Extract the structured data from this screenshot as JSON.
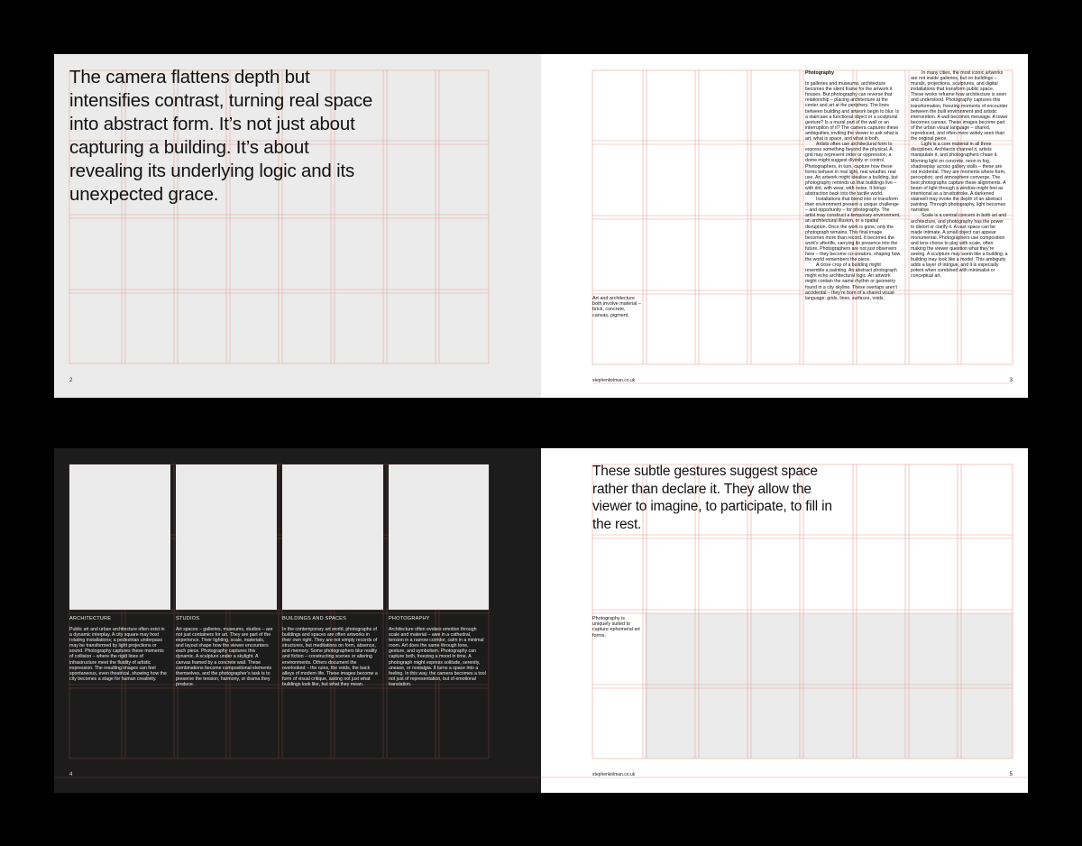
{
  "spread1": {
    "left": {
      "quote": "The camera flattens depth but intensifies contrast, turning real space into abstract form. It’s not just about capturing a building. It’s about revealing its underlying logic and its unexpected grace.",
      "page_number": "2"
    },
    "right": {
      "caption": "Art and architecture both involve material – brick, concrete, canvas, pigment.",
      "heading": "Photography",
      "col1": [
        "In galleries and museums, architecture becomes the silent frame for the artwork it houses. But photography can reverse that relationship – placing architecture at the center and art at the periphery. The lines between building and artwork begin to blur. Is a staircase a functional object or a sculptural gesture? Is a mural part of the wall or an interruption of it? The camera captures these ambiguities, inviting the viewer to ask what is art, what is space, and what is both.",
        "Artists often use architectural form to express something beyond the physical. A grid may represent order or oppression; a dome might suggest divinity or control. Photographers, in turn, capture how these forms behave in real light, real weather, real use. An artwork might idealise a building, but photography reminds us that buildings live – with dirt, with wear, with noise. It brings abstraction back into the tactile world.",
        "Installations that blend into or transform their environment present a unique challenge – and opportunity – for photography. The artist may construct a temporary environment, an architectural illusion, or a spatial disruption. Once the work is gone, only the photograph remains. This final image becomes more than record. It becomes the work’s afterlife, carrying its presence into the future. Photographers are not just observers here – they become co-creators, shaping how the world remembers the piece.",
        "A close crop of a building might resemble a painting. An abstract photograph might echo architectural logic. An artwork might contain the same rhythm or geometry found in a city skyline. These overlaps aren’t accidental – they’re born of a shared visual language: grids, lines, surfaces, voids."
      ],
      "col2": [
        "In many cities, the most iconic artworks are not inside galleries, but on buildings – murals, projections, sculptures, and digital installations that transform public space. These works reframe how architecture is seen and understood. Photography captures this transformation, freezing moments of encounter between the built environment and artistic intervention. A wall becomes message. A tower becomes canvas. These images become part of the urban visual language – shared, reproduced, and often more widely seen than the original piece.",
        "Light is a core material in all three disciplines. Architects channel it, artists manipulate it, and photographers chase it. Morning light on concrete, neon in fog, shadowplay across gallery walls – these are not incidental. They are moments where form, perception, and atmosphere converge. The best photographs capture these alignments. A beam of light through a window might feel as intentional as a brushstroke. A darkened stairwell may evoke the depth of an abstract painting. Through photography, light becomes narrative.",
        "Scale is a central concern in both art and architecture, and photography has the power to distort or clarify it. A vast space can be made intimate. A small object can appear monumental. Photographers use composition and lens choice to play with scale, often making the viewer question what they’re seeing. A sculpture may seem like a building; a building may look like a model. This ambiguity adds a layer of intrigue, and it is especially potent when combined with minimalist or conceptual art."
      ],
      "footer_url": "stephenkelman.co.uk",
      "page_number": "3"
    }
  },
  "spread2": {
    "left": {
      "cards": [
        {
          "title": "ARCHITECTURE",
          "text": "Public art and urban architecture often exist in a dynamic interplay. A city square may host rotating installations; a pedestrian underpass may be transformed by light projections or sound. Photography captures these moments of collision – where the rigid lines of infrastructure meet the fluidity of artistic expression. The resulting images can feel spontaneous, even theatrical, showing how the city becomes a stage for human creativity."
        },
        {
          "title": "STUDIOS",
          "text": "Art spaces – galleries, museums, studios – are not just containers for art. They are part of the experience. Their lighting, scale, materials, and layout shape how the viewer encounters each piece. Photography captures this dynamic. A sculpture under a skylight. A canvas framed by a concrete wall. These combinations become compositional elements themselves, and the photographer’s task is to preserve the tension, harmony, or drama they produce."
        },
        {
          "title": "BUILDINGS AND SPACES",
          "text": "In the contemporary art world, photographs of buildings and spaces are often artworks in their own right. They are not simply records of structures, but meditations on form, absence, and memory. Some photographers blur reality and fiction – constructing scenes or altering environments. Others document the overlooked – the ruins, the voids, the back alleys of modern life. These images become a form of visual critique, asking not just what buildings look like, but what they mean."
        },
        {
          "title": "PHOTOGRAPHY",
          "text": "Architecture often evokes emotion through scale and material – awe in a cathedral, tension in a narrow corridor, calm in a minimal room. Art does the same through tone, gesture, and symbolism. Photography can capture both, freezing a mood in time. A photograph might express solitude, serenity, unease, or nostalgia. It turns a space into a feeling. In this way, the camera becomes a tool not just of representation, but of emotional translation."
        }
      ],
      "page_number": "4"
    },
    "right": {
      "quote": "These subtle gestures suggest space rather than declare it. They allow the viewer to imagine, to participate, to fill in the rest.",
      "caption": "Photography is uniquely suited to capture ephemeral art forms.",
      "footer_url": "stephenkelman.co.uk",
      "page_number": "5"
    }
  },
  "colors": {
    "background": "#000000",
    "light_page": "#ebebeb",
    "white_page": "#ffffff",
    "dark_page": "#1c1c1c",
    "grid_line": "#e8a39b"
  }
}
